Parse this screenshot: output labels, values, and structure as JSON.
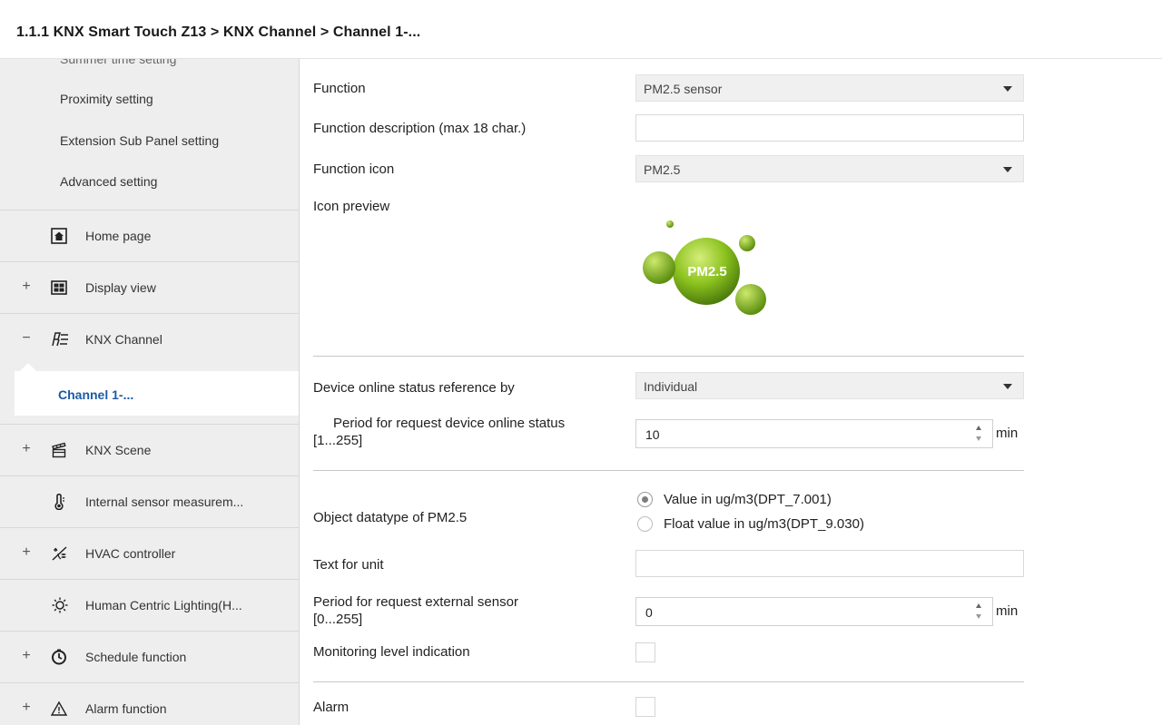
{
  "header": {
    "breadcrumb": "1.1.1 KNX Smart Touch Z13 > KNX Channel  > Channel 1-..."
  },
  "sidebar": {
    "partial_item": "Summer time setting",
    "sub_items": [
      "Proximity setting",
      "Extension Sub Panel setting",
      "Advanced setting"
    ],
    "nav": [
      {
        "toggle": "",
        "icon": "home-icon",
        "label": "Home page"
      },
      {
        "toggle": "+",
        "icon": "display-view-icon",
        "label": "Display view"
      },
      {
        "toggle": "−",
        "icon": "knx-channel-icon",
        "label": "KNX Channel"
      },
      {
        "toggle": "+",
        "icon": "knx-scene-icon",
        "label": "KNX Scene"
      },
      {
        "toggle": "",
        "icon": "sensor-icon",
        "label": "Internal sensor measurem..."
      },
      {
        "toggle": "+",
        "icon": "hvac-icon",
        "label": "HVAC controller"
      },
      {
        "toggle": "",
        "icon": "light-icon",
        "label": "Human Centric Lighting(H..."
      },
      {
        "toggle": "+",
        "icon": "clock-icon",
        "label": "Schedule function"
      },
      {
        "toggle": "+",
        "icon": "warning-icon",
        "label": "Alarm function"
      }
    ],
    "selected_item": "Channel 1-..."
  },
  "form": {
    "function": {
      "label": "Function",
      "value": "PM2.5 sensor"
    },
    "description": {
      "label": "Function description (max 18 char.)",
      "value": ""
    },
    "icon": {
      "label": "Function icon",
      "value": "PM2.5"
    },
    "preview": {
      "label": "Icon preview",
      "badge_text": "PM2.5"
    },
    "online_ref": {
      "label": "Device online status reference by",
      "value": "Individual"
    },
    "online_period": {
      "label_line1": "Period for request device online status",
      "label_line2": "[1...255]",
      "value": "10",
      "unit": "min"
    },
    "datatype": {
      "label": "Object datatype of PM2.5",
      "options": [
        "Value in ug/m3(DPT_7.001)",
        "Float value in ug/m3(DPT_9.030)"
      ],
      "selected_index": 0
    },
    "unit_text": {
      "label": "Text for unit",
      "value": ""
    },
    "ext_period": {
      "label_line1": "Period for request external sensor",
      "label_line2": "[0...255]",
      "value": "0",
      "unit": "min"
    },
    "monitoring": {
      "label": "Monitoring level indication",
      "checked": false
    },
    "alarm": {
      "label": "Alarm",
      "checked": false
    }
  },
  "colors": {
    "sidebar_bg": "#eeeeee",
    "selected_text": "#1c5aa6",
    "icon_green": "#7cb518"
  }
}
